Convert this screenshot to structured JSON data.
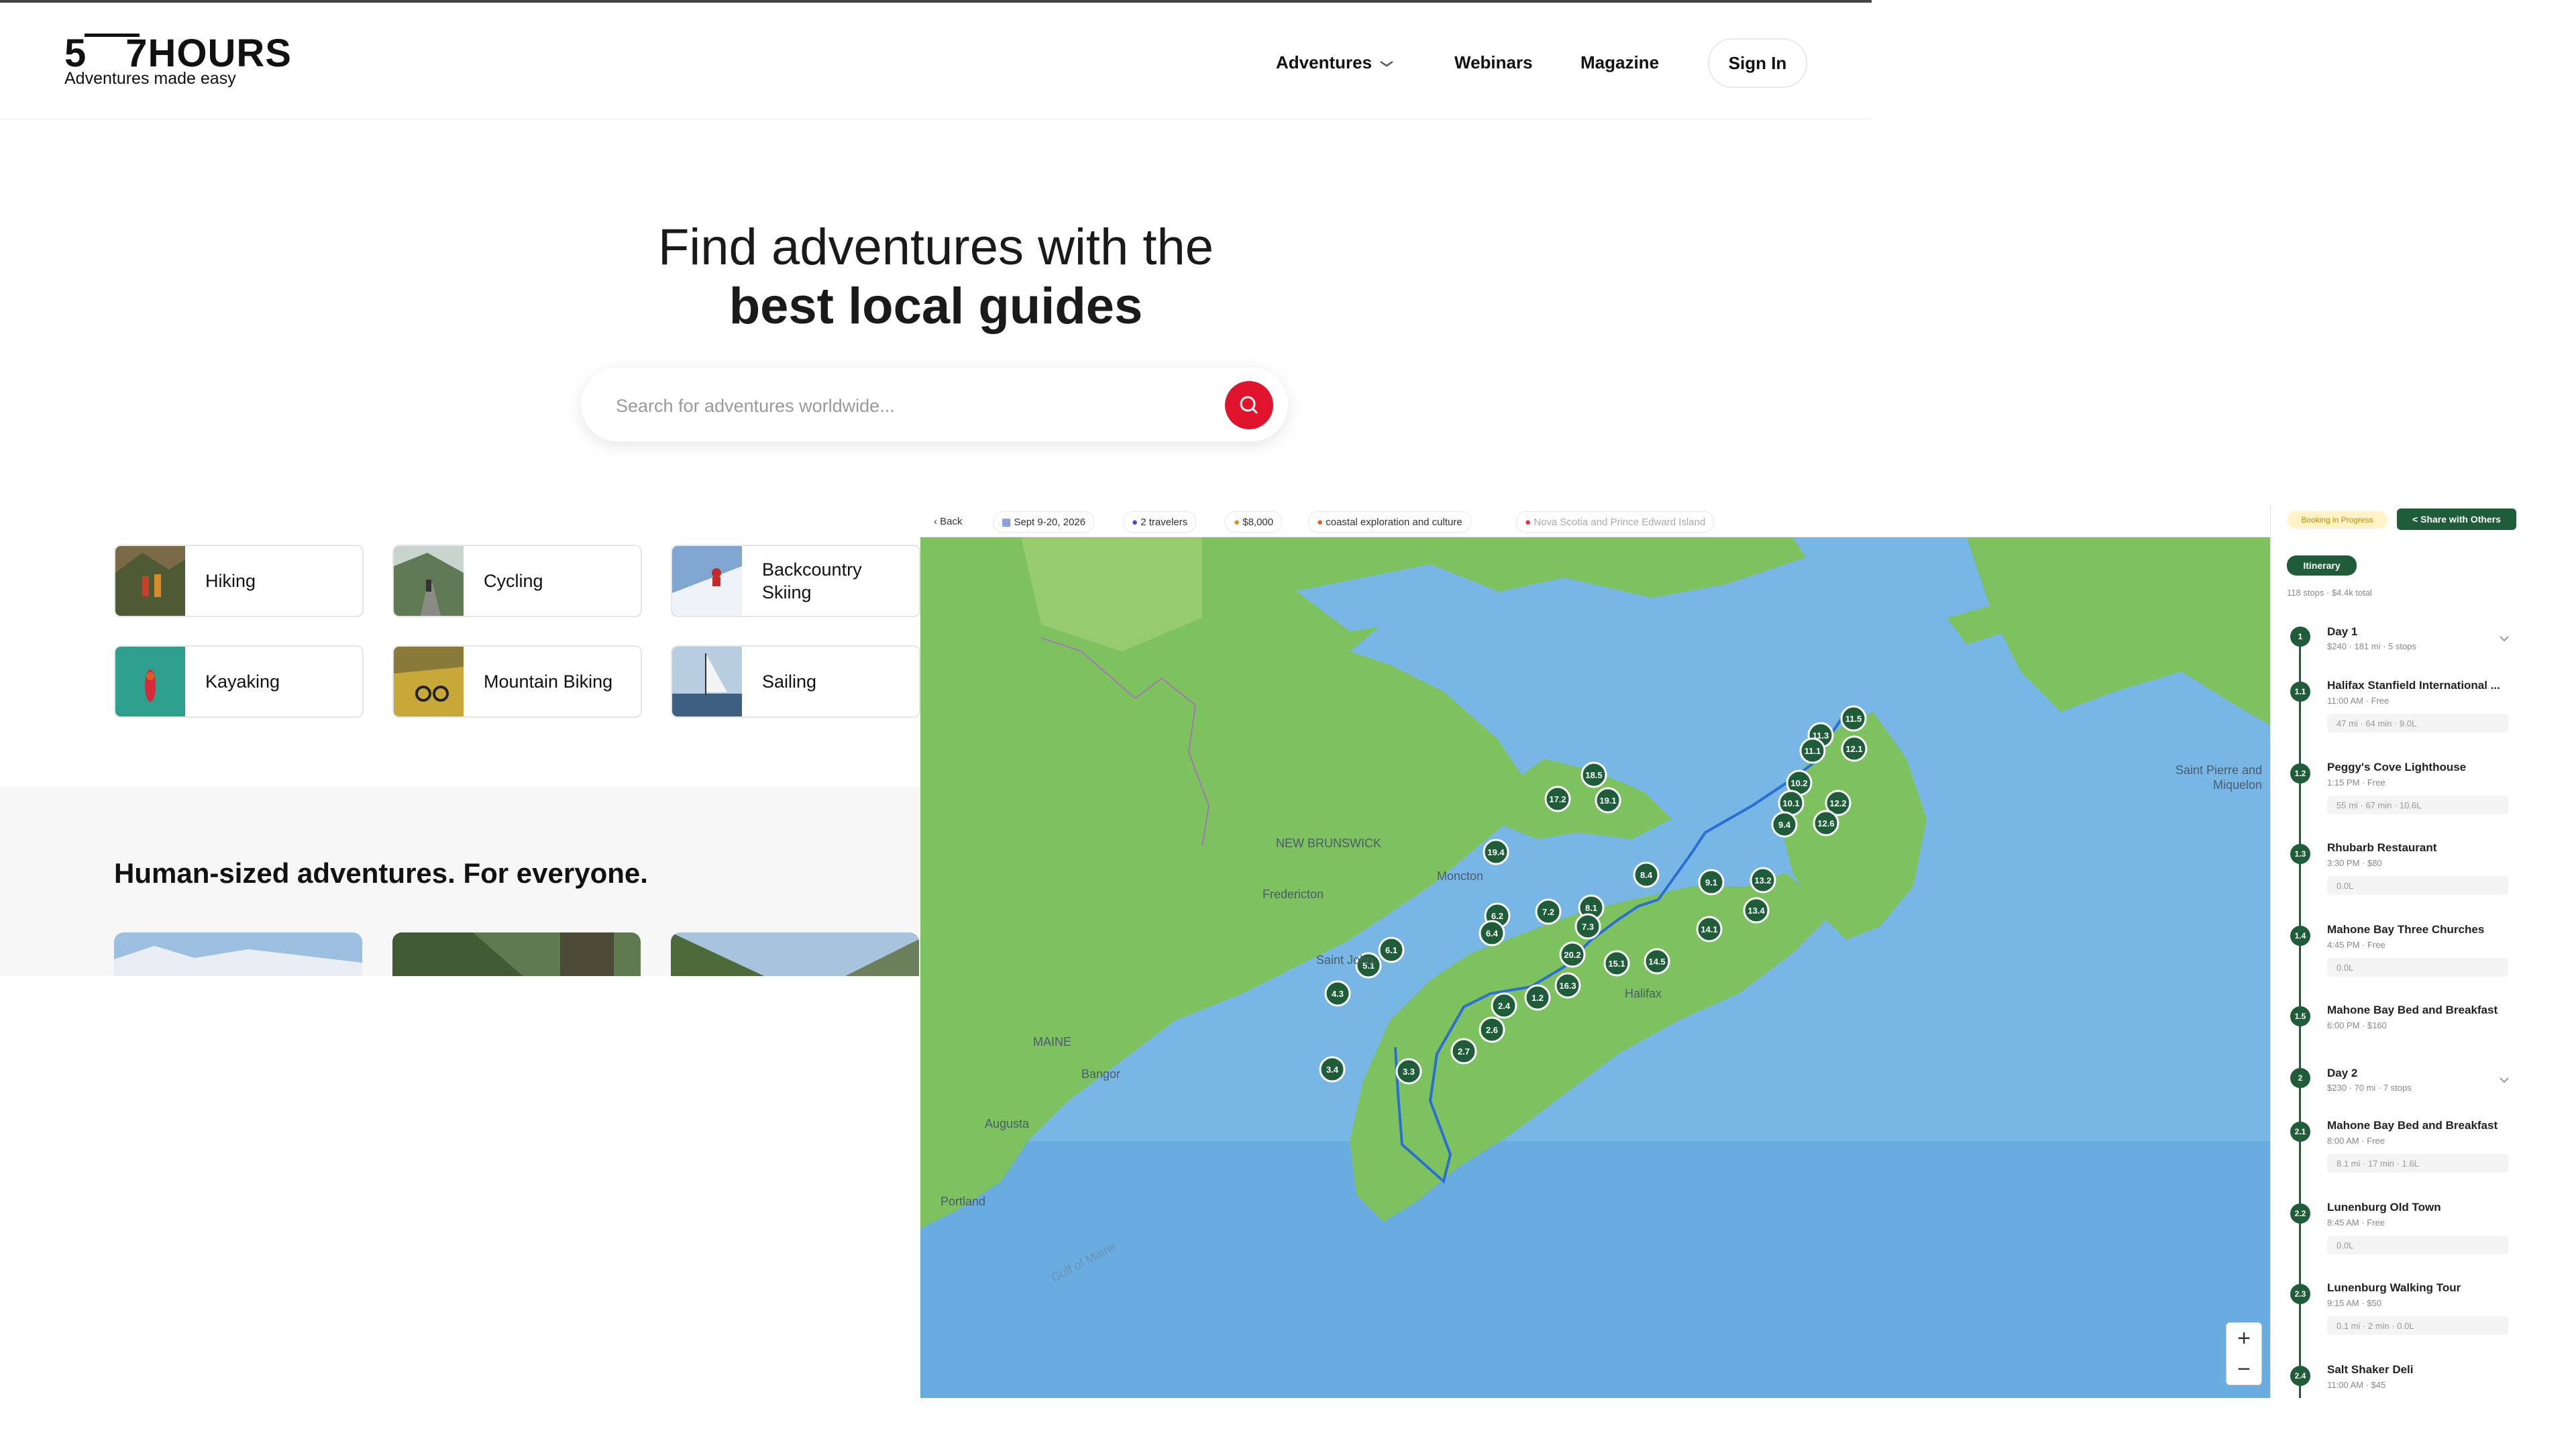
{
  "header": {
    "logo": "5⁠ 7HOURS",
    "logo_left": "5",
    "logo_right": "7HOURS",
    "tagline": "Adventures made easy",
    "nav": [
      "Adventures",
      "Webinars",
      "Magazine"
    ],
    "sign_in": "Sign In"
  },
  "hero": {
    "line1": "Find adventures with the",
    "line2": "best local guides",
    "search_placeholder": "Search for adventures worldwide..."
  },
  "categories": [
    {
      "label": "Hiking",
      "thumb_color": "#6e5a3a"
    },
    {
      "label": "Cycling",
      "thumb_color": "#7a8a6a"
    },
    {
      "label": "Backcountry Skiing",
      "thumb_color": "#8fb3d8"
    },
    {
      "label": "Kayaking",
      "thumb_color": "#2aa08a"
    },
    {
      "label": "Mountain Biking",
      "thumb_color": "#b8a24a"
    },
    {
      "label": "Sailing",
      "thumb_color": "#9fb8cf"
    }
  ],
  "section": {
    "title": "Human-sized adventures. For everyone."
  },
  "app": {
    "toolbar": {
      "back": "Back",
      "dates": "Sept 9-20, 2026",
      "travelers": "2 travelers",
      "budget": "$8,000",
      "theme": "coastal exploration and culture",
      "region": "Nova Scotia and Prince Edward Island"
    },
    "panel": {
      "booking": "Booking in Progress",
      "share": "Share with Others",
      "tab": "Itinerary",
      "summary": "118 stops · $4.4k total",
      "day1": {
        "title": "Day 1",
        "meta": "$240 · 181 mi · 5 stops"
      },
      "day2": {
        "title": "Day 2",
        "meta": "$230 · 70 mi · 7 stops"
      },
      "items": [
        {
          "num": "1.1",
          "title": "Halifax Stanfield International ...",
          "meta": "11:00 AM · Free",
          "travel": "47 mi · 64 min · 9.0L"
        },
        {
          "num": "1.2",
          "title": "Peggy's Cove Lighthouse",
          "meta": "1:15 PM · Free",
          "travel": "55 mi · 67 min · 10.6L"
        },
        {
          "num": "1.3",
          "title": "Rhubarb Restaurant",
          "meta": "3:30 PM · $80",
          "travel": "0.0L"
        },
        {
          "num": "1.4",
          "title": "Mahone Bay Three Churches",
          "meta": "4:45 PM · Free",
          "travel": "0.0L"
        },
        {
          "num": "1.5",
          "title": "Mahone Bay Bed and Breakfast",
          "meta": "6:00 PM · $160",
          "travel": ""
        },
        {
          "num": "2.1",
          "title": "Mahone Bay Bed and Breakfast",
          "meta": "8:00 AM · Free",
          "travel": "8.1 mi · 17 min · 1.6L"
        },
        {
          "num": "2.2",
          "title": "Lunenburg Old Town",
          "meta": "8:45 AM · Free",
          "travel": "0.0L"
        },
        {
          "num": "2.3",
          "title": "Lunenburg Walking Tour",
          "meta": "9:15 AM · $50",
          "travel": "0.1 mi · 2 min · 0.0L"
        },
        {
          "num": "2.4",
          "title": "Salt Shaker Deli",
          "meta": "11:00 AM · $45",
          "travel": ""
        }
      ]
    },
    "map": {
      "labels": [
        "NEW BRUNSWICK",
        "MAINE",
        "Fredericton",
        "Saint John",
        "Moncton",
        "Halifax",
        "Saint Pierre and Miquelon",
        "Gulf of Maine",
        "Bangor",
        "Augusta",
        "Portland"
      ],
      "markers": [
        "11.5",
        "11.3",
        "11.1",
        "12.1",
        "10.2",
        "10.1",
        "9.4",
        "12.2",
        "12.6",
        "18.5",
        "19.1",
        "17.2",
        "19.4",
        "8.4",
        "9.1",
        "13.2",
        "13.4",
        "14.1",
        "8.1",
        "7.2",
        "7.3",
        "6.2",
        "6.4",
        "20.2",
        "15.1",
        "14.5",
        "16.3",
        "1.2",
        "2.4",
        "2.6",
        "2.7",
        "6.1",
        "5.1",
        "4.3",
        "3.4",
        "3.3"
      ]
    }
  }
}
